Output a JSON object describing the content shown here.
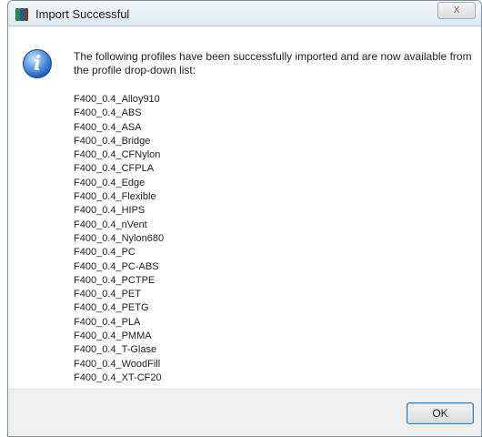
{
  "window": {
    "title": "Import Successful",
    "close_label": "X"
  },
  "icons": {
    "app": "app-icon",
    "info": "information-icon",
    "info_glyph": "i"
  },
  "message": "The following profiles have been successfully imported and are now available from the profile drop-down list:",
  "profiles": [
    "F400_0.4_Alloy910",
    "F400_0.4_ABS",
    "F400_0.4_ASA",
    "F400_0.4_Bridge",
    "F400_0.4_CFNylon",
    "F400_0.4_CFPLA",
    "F400_0.4_Edge",
    "F400_0.4_Flexible",
    "F400_0.4_HIPS",
    "F400_0.4_nVent",
    "F400_0.4_Nylon680",
    "F400_0.4_PC",
    "F400_0.4_PC-ABS",
    "F400_0.4_PCTPE",
    "F400_0.4_PET",
    "F400_0.4_PETG",
    "F400_0.4_PLA",
    "F400_0.4_PMMA",
    "F400_0.4_T-Glase",
    "F400_0.4_WoodFill",
    "F400_0.4_XT-CF20"
  ],
  "buttons": {
    "ok_label": "OK"
  },
  "colors": {
    "accent": "#3c7fb1",
    "info_blue": "#1c5fb8"
  }
}
